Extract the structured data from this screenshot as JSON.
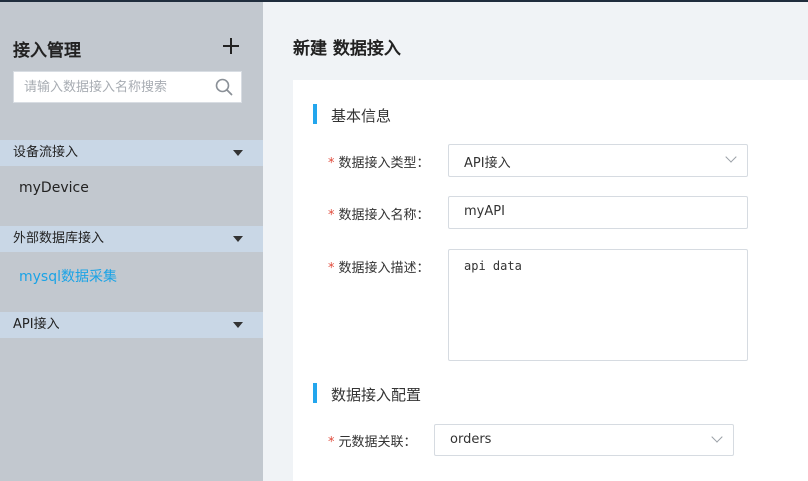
{
  "sidebar": {
    "title": "接入管理",
    "search_placeholder": "请输入数据接入名称搜索",
    "groups": [
      {
        "label": "设备流接入",
        "items": [
          {
            "label": "myDevice",
            "active": false
          }
        ]
      },
      {
        "label": "外部数据库接入",
        "items": [
          {
            "label": "mysql数据采集",
            "active": true
          }
        ]
      },
      {
        "label": "API接入",
        "items": []
      }
    ]
  },
  "main": {
    "title": "新建 数据接入",
    "sections": [
      {
        "title": "基本信息",
        "fields": [
          {
            "label": "数据接入类型：",
            "type": "select",
            "value": "API接入",
            "required": true
          },
          {
            "label": "数据接入名称：",
            "type": "input",
            "value": "myAPI",
            "required": true
          },
          {
            "label": "数据接入描述：",
            "type": "textarea",
            "value": "api data",
            "required": true
          }
        ]
      },
      {
        "title": "数据接入配置",
        "fields": [
          {
            "label": "元数据关联：",
            "type": "select",
            "value": "orders",
            "required": true
          }
        ]
      }
    ],
    "required_mark": "*"
  },
  "colors": {
    "accent": "#23a6ed",
    "active_item": "#1aa3e6",
    "required": "#e04a3b",
    "sidebar_bg": "#c2c8cf",
    "group_header_bg": "#c9d7e6"
  },
  "icons": {
    "add": "plus-icon",
    "search": "search-icon",
    "expand": "caret-down-icon",
    "dropdown": "chevron-down-icon"
  }
}
